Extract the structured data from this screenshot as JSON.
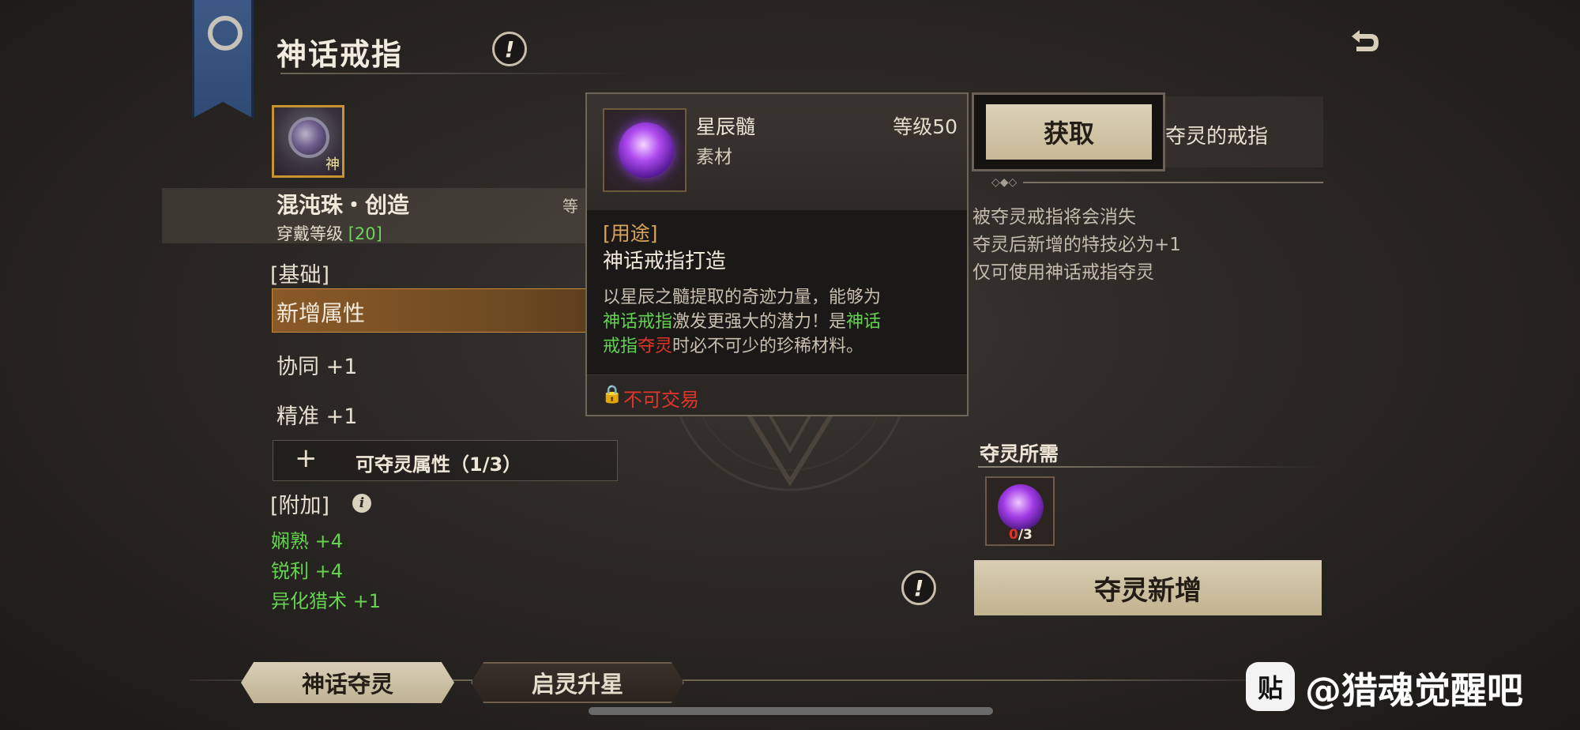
{
  "header": {
    "title": "神话戒指",
    "info_glyph": "!",
    "back_icon": "back-arrow-icon"
  },
  "item": {
    "icon_tag": "神",
    "name": "混沌珠・创造",
    "level_partial": "等",
    "wear_label": "穿戴等级",
    "wear_value": "[20]"
  },
  "attributes": {
    "basic_header": "[基础]",
    "new_attr_label": "新增属性",
    "stats": [
      "协同 +1",
      "精准 +1"
    ],
    "steal_plus": "+",
    "steal_label": "可夺灵属性（1/3）",
    "extra_header": "[附加]",
    "extra_info": "i",
    "extra_stats": [
      "娴熟 +4",
      "锐利 +4",
      "异化猎术 +1"
    ]
  },
  "right_panel": {
    "obtain_button": "获取",
    "ring_text": "夺灵的戒指",
    "notes": [
      "被夺灵戒指将会消失",
      "夺灵后新增的特技必为+1",
      "仅可使用神话戒指夺灵"
    ],
    "need_label": "夺灵所需",
    "need_have": "0",
    "need_total": "/3",
    "warn_glyph": "!",
    "steal_add_button": "夺灵新增"
  },
  "tooltip": {
    "name": "星辰髓",
    "type": "素材",
    "level": "等级50",
    "use_header": "[用途]",
    "use": "神话戒指打造",
    "desc_1": "以星辰之髓提取的奇迹力量，能够为",
    "desc_2a": "神话戒指",
    "desc_2b": "激发更强大的潜力！是",
    "desc_2c": "神话",
    "desc_3a": "戒指",
    "desc_3b": "夺灵",
    "desc_3c": "时必不可少的珍稀材料。",
    "lock_glyph": "🔒",
    "trade": "不可交易"
  },
  "tabs": [
    {
      "label": "神话夺灵",
      "active": true
    },
    {
      "label": "启灵升星",
      "active": false
    }
  ],
  "watermark": {
    "icon_text": "贴",
    "text": "@猎魂觉醒吧"
  },
  "colors": {
    "accent_gold": "#c9942f",
    "stat_green": "#65d34f",
    "warn_red": "#e0352b",
    "use_orange": "#d9a25a"
  }
}
